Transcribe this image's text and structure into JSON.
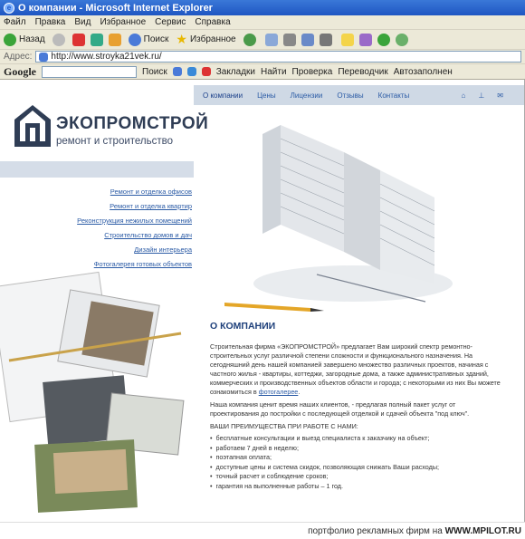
{
  "window": {
    "title": "О компании - Microsoft Internet Explorer"
  },
  "menu": [
    "Файл",
    "Правка",
    "Вид",
    "Избранное",
    "Сервис",
    "Справка"
  ],
  "toolbar": {
    "back": "Назад",
    "search": "Поиск",
    "favorites": "Избранное"
  },
  "address": {
    "label": "Адрес:",
    "url": "http://www.stroyka21vek.ru/"
  },
  "google_bar": {
    "logo": "Google",
    "search": "Поиск",
    "bookmarks": "Закладки",
    "find": "Найти",
    "check": "Проверка",
    "translate": "Переводчик",
    "autofill": "Автозаполнен"
  },
  "site": {
    "logo_name": "ЭКОПРОМСТРОЙ",
    "logo_tagline": "ремонт и строительство",
    "topnav": [
      "О компании",
      "Цены",
      "Лицензии",
      "Отзывы",
      "Контакты"
    ],
    "leftnav": [
      "Ремонт и отделка офисов",
      "Ремонт и отделка квартир",
      "Реконструкция нежилых помещений",
      "Строительство домов и дач",
      "Дизайн интерьера",
      "Фотогалерея готовых объектов"
    ],
    "about_title": "О КОМПАНИИ",
    "para1_text": "Строительная фирма «ЭКОПРОМСТРОЙ» предлагает Вам широкий спектр ремонтно-строительных услуг различной степени сложности и функционального назначения.  На сегодняшний день нашей компанией завершено множество различных проектов, начиная с частного жилья - квартиры, коттеджи, загородные дома, а также административных зданий, коммерческих и производственных объектов области и города; с некоторыми из них Вы можете ознакомиться в ",
    "para1_link": "фотогалерее",
    "para1_end": ".",
    "para2": "Наша компания ценит время наших клиентов, - предлагая полный пакет услуг от проектирования до постройки с последующей отделкой и сдачей объекта \"под ключ\".",
    "advantages_title": "ВАШИ ПРЕИМУЩЕСТВА ПРИ РАБОТЕ С НАМИ:",
    "advantages": [
      "бесплатные консультации и выезд специалиста к заказчику на объект;",
      "работаем 7 дней в неделю;",
      "поэтапная оплата;",
      "доступные цены и система скидок, позволяющая снижать Ваши расходы;",
      "точный расчет и соблюдение сроков;",
      "гарантия на выполненные работы – 1 год."
    ]
  },
  "footer": {
    "text": "портфолио рекламных фирм на ",
    "brand": "WWW.MPILOT.RU"
  },
  "colors": {
    "title_bar": "#1f56c2",
    "link": "#2a5aa5",
    "nav_band": "#cfd9e5",
    "logo": "#2f3d55"
  }
}
